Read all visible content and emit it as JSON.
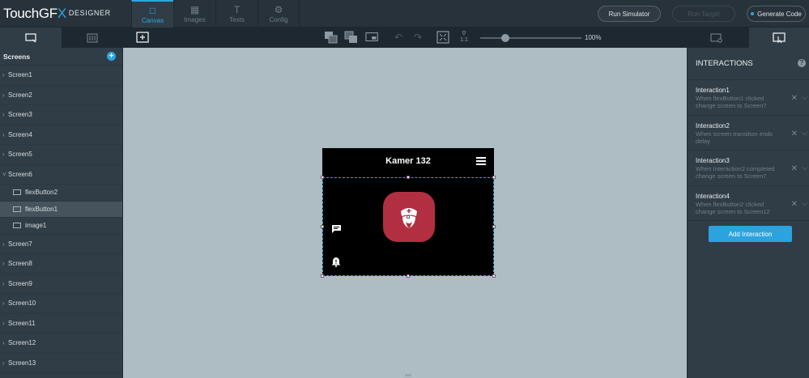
{
  "app": {
    "logo_main": "TouchGF",
    "logo_x": "X",
    "logo_sub": "DESIGNER"
  },
  "tabs": [
    {
      "label": "Canvas",
      "icon": "canvas-icon",
      "active": true
    },
    {
      "label": "Images",
      "icon": "images-icon",
      "active": false
    },
    {
      "label": "Texts",
      "icon": "texts-icon",
      "active": false
    },
    {
      "label": "Config",
      "icon": "config-icon",
      "active": false
    }
  ],
  "actions": {
    "run_simulator": "Run Simulator",
    "run_target": "Run Target",
    "generate_code": "Generate Code"
  },
  "toolbar": {
    "zoom_label": "100%",
    "zoom_fraction": 0.25,
    "fit_label": "1:1"
  },
  "left_panel": {
    "header": "Screens",
    "items": [
      {
        "label": "Screen1",
        "type": "screen"
      },
      {
        "label": "Screen2",
        "type": "screen"
      },
      {
        "label": "Screen3",
        "type": "screen"
      },
      {
        "label": "Screen4",
        "type": "screen"
      },
      {
        "label": "Screen5",
        "type": "screen"
      },
      {
        "label": "Screen6",
        "type": "screen",
        "expanded": true
      },
      {
        "label": "flexButton2",
        "type": "widget"
      },
      {
        "label": "flexButton1",
        "type": "widget",
        "selected": true
      },
      {
        "label": "image1",
        "type": "widget"
      },
      {
        "label": "Screen7",
        "type": "screen"
      },
      {
        "label": "Screen8",
        "type": "screen"
      },
      {
        "label": "Screen9",
        "type": "screen"
      },
      {
        "label": "Screen10",
        "type": "screen"
      },
      {
        "label": "Screen11",
        "type": "screen"
      },
      {
        "label": "Screen12",
        "type": "screen"
      },
      {
        "label": "Screen13",
        "type": "screen"
      }
    ]
  },
  "device": {
    "title": "Kamer 132",
    "app_icon_color": "#b22f42"
  },
  "interactions": {
    "title": "INTERACTIONS",
    "items": [
      {
        "name": "Interaction1",
        "line1": "When flexButton1 clicked",
        "line2": "change screen to Screen7"
      },
      {
        "name": "Interaction2",
        "line1": "When screen transition ends",
        "line2": "delay"
      },
      {
        "name": "Interaction3",
        "line1": "When Interaction2 completed",
        "line2": "change screen to Screen7"
      },
      {
        "name": "Interaction4",
        "line1": "When flexButton2 clicked",
        "line2": "change screen to Screen12"
      }
    ],
    "add_label": "Add Interaction"
  },
  "colors": {
    "accent": "#28a8e0",
    "canvas_bg": "#aebcc3",
    "panel_bg": "#313d46"
  }
}
